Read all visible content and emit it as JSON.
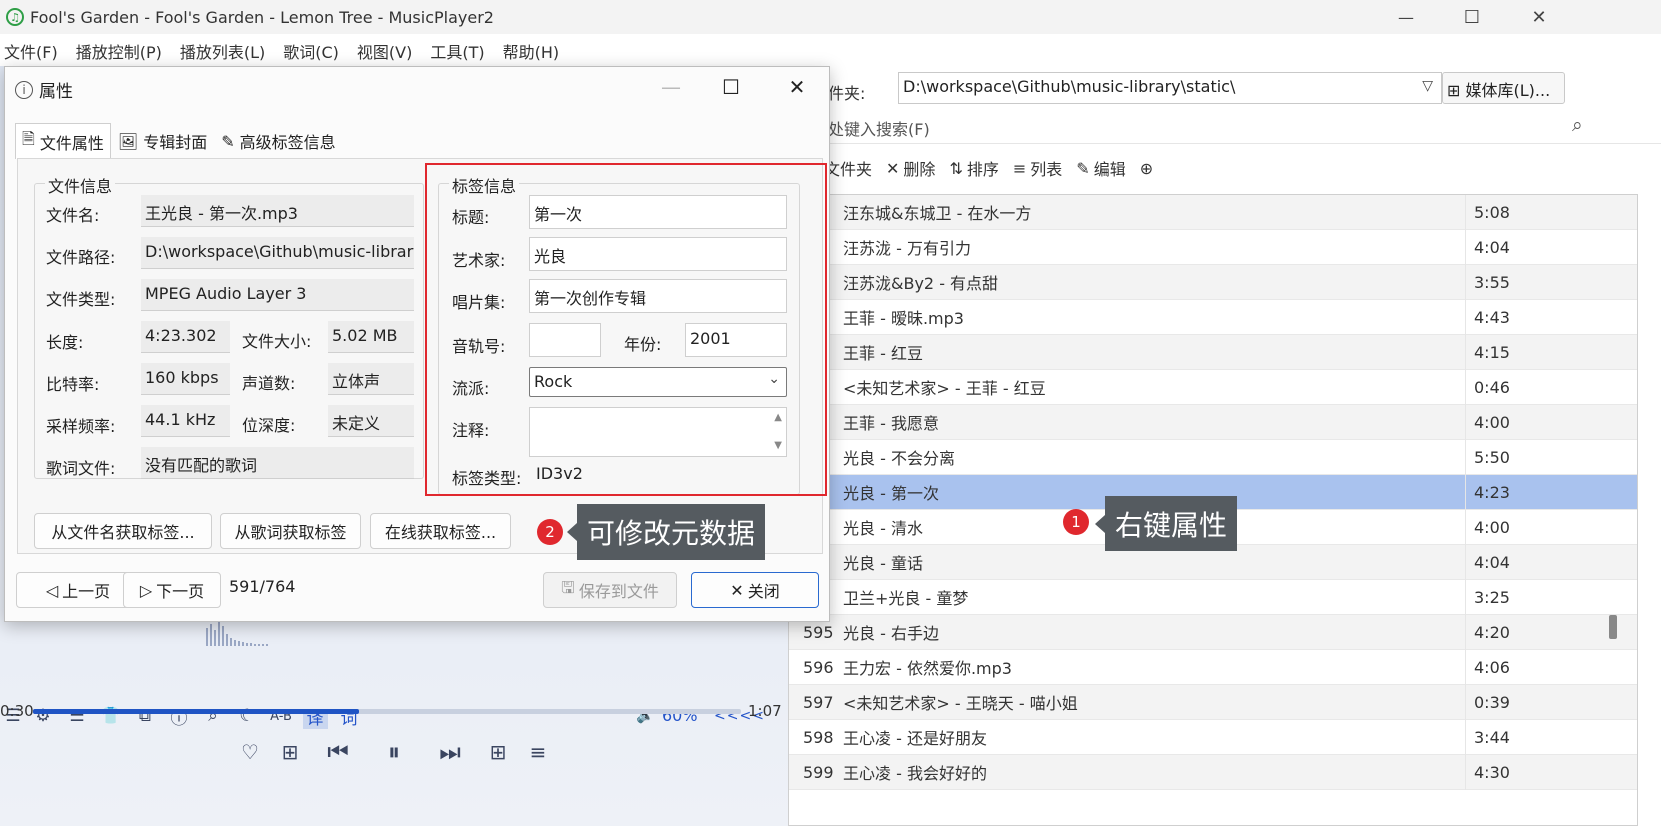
{
  "window": {
    "title": "Fool's Garden - Fool's Garden - Lemon Tree - MusicPlayer2",
    "controls": {
      "minimize": "—",
      "maximize": "☐",
      "close": "✕"
    }
  },
  "menu": [
    "文件(F)",
    "播放控制(P)",
    "播放列表(L)",
    "歌词(C)",
    "视图(V)",
    "工具(T)",
    "帮助(H)"
  ],
  "right": {
    "folder_label": "文件夹:",
    "folder_label_visible": "件夹:",
    "folder_path": "D:\\workspace\\Github\\music-library\\static\\",
    "library_button": "媒体库(L)...",
    "search_placeholder": "处键入搜索(F)",
    "toolbar": {
      "folder": "文件夹",
      "delete": "删除",
      "sort": "排序",
      "list": "列表",
      "edit": "编辑"
    },
    "rows": [
      {
        "num": "",
        "name": "汪东城&东城卫 - 在水一方",
        "dur": "5:08"
      },
      {
        "num": "",
        "name": "汪苏泷 - 万有引力",
        "dur": "4:04"
      },
      {
        "num": "",
        "name": "汪苏泷&By2 - 有点甜",
        "dur": "3:55"
      },
      {
        "num": "",
        "name": "王菲 - 暧昧.mp3",
        "dur": "4:43"
      },
      {
        "num": "",
        "name": "王菲 - 红豆",
        "dur": "4:15"
      },
      {
        "num": "",
        "name": "<未知艺术家> - 王菲 - 红豆",
        "dur": "0:46"
      },
      {
        "num": "",
        "name": "王菲 - 我愿意",
        "dur": "4:00"
      },
      {
        "num": "",
        "name": "光良 - 不会分离",
        "dur": "5:50"
      },
      {
        "num": "",
        "name": "光良 - 第一次",
        "dur": "4:23"
      },
      {
        "num": "",
        "name": "光良 - 清水",
        "dur": "4:00"
      },
      {
        "num": "",
        "name": "光良 - 童话",
        "dur": "4:04"
      },
      {
        "num": "",
        "name": "卫兰+光良 - 童梦",
        "dur": "3:25"
      },
      {
        "num": "595",
        "name": "光良 - 右手边",
        "dur": "4:20"
      },
      {
        "num": "596",
        "name": "王力宏 - 依然爱你.mp3",
        "dur": "4:06"
      },
      {
        "num": "597",
        "name": "<未知艺术家> - 王晓天 - 喵小姐",
        "dur": "0:39"
      },
      {
        "num": "598",
        "name": "王心凌 - 还是好朋友",
        "dur": "3:44"
      },
      {
        "num": "599",
        "name": "王心凌 - 我会好好的",
        "dur": "4:30"
      }
    ],
    "selected_index": 8
  },
  "callouts": {
    "one": {
      "num": "1",
      "text": "右键属性"
    },
    "two": {
      "num": "2",
      "text": "可修改元数据"
    }
  },
  "player": {
    "time_elapsed": "0:30",
    "time_total": "1:07",
    "progress": 0.46,
    "volume": "60%",
    "seek_arrows": "<<<<",
    "ab_label": "A-B",
    "translate_label": "译",
    "lyric_label": "词"
  },
  "dialog": {
    "title": "属性",
    "tabs": [
      "文件属性",
      "专辑封面",
      "高级标签信息"
    ],
    "file_info": {
      "group_title": "文件信息",
      "filename_label": "文件名:",
      "filename": "王光良 - 第一次.mp3",
      "path_label": "文件路径:",
      "path": "D:\\workspace\\Github\\music-library\\static\\",
      "type_label": "文件类型:",
      "type": "MPEG Audio Layer 3",
      "length_label": "长度:",
      "length": "4:23.302",
      "size_label": "文件大小:",
      "size": "5.02 MB",
      "bitrate_label": "比特率:",
      "bitrate": "160 kbps",
      "channels_label": "声道数:",
      "channels": "立体声",
      "samplerate_label": "采样频率:",
      "samplerate": "44.1 kHz",
      "bitdepth_label": "位深度:",
      "bitdepth": "未定义",
      "lyric_label": "歌词文件:",
      "lyric": "没有匹配的歌词"
    },
    "tag_info": {
      "group_title": "标签信息",
      "title_label": "标题:",
      "title": "第一次",
      "artist_label": "艺术家:",
      "artist": "光良",
      "album_label": "唱片集:",
      "album": "第一次创作专辑",
      "track_label": "音轨号:",
      "track": "",
      "year_label": "年份:",
      "year": "2001",
      "genre_label": "流派:",
      "genre": "Rock",
      "comment_label": "注释:",
      "comment": "",
      "tagtype_label": "标签类型:",
      "tagtype": "ID3v2"
    },
    "buttons": {
      "from_filename": "从文件名获取标签...",
      "from_lyric": "从歌词获取标签",
      "online": "在线获取标签...",
      "prev": "上一页",
      "next": "下一页",
      "page": "591/764",
      "save": "保存到文件",
      "close": "关闭"
    }
  }
}
